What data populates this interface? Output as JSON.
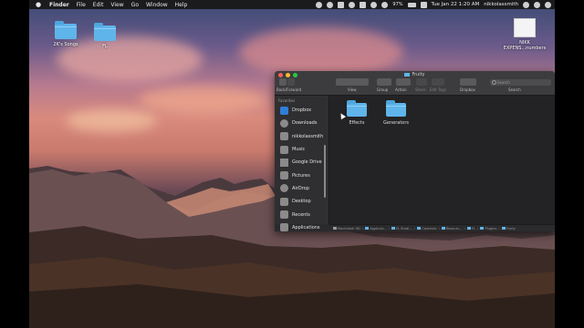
{
  "menubar": {
    "apple": "",
    "items": [
      "Finder",
      "File",
      "Edit",
      "View",
      "Go",
      "Window",
      "Help"
    ],
    "battery": "97%",
    "datetime": "Tue Jan 22  1:20 AM",
    "user": "nikkolassmith"
  },
  "desktop": [
    {
      "label": "2K's Songs"
    },
    {
      "label": "FL"
    },
    {
      "label": "NIKK\nEXPENS...numbers"
    }
  ],
  "finder": {
    "title": "Fruity",
    "toolbar": {
      "nav_label": "Back/Forward",
      "view_label": "View",
      "group_label": "Group",
      "action_label": "Action",
      "share_label": "Share",
      "edit_tags_label": "Edit Tags",
      "dropbox_label": "Dropbox",
      "search_label": "Search",
      "search_placeholder": "Search"
    },
    "sidebar": {
      "heading": "Favorites",
      "items": [
        {
          "label": "Dropbox",
          "icon": "dropbox-icon"
        },
        {
          "label": "Downloads",
          "icon": "downloads-icon"
        },
        {
          "label": "nikkolassmith",
          "icon": "home-icon"
        },
        {
          "label": "Music",
          "icon": "music-icon"
        },
        {
          "label": "Google Drive",
          "icon": "google-drive-icon"
        },
        {
          "label": "Pictures",
          "icon": "pictures-icon"
        },
        {
          "label": "AirDrop",
          "icon": "airdrop-icon"
        },
        {
          "label": "Desktop",
          "icon": "desktop-icon"
        },
        {
          "label": "Recents",
          "icon": "recents-icon"
        },
        {
          "label": "Applications",
          "icon": "applications-icon"
        }
      ]
    },
    "items": [
      {
        "label": "Effects"
      },
      {
        "label": "Generators"
      }
    ],
    "path": [
      "Macintosh HD",
      "Applicat...",
      "FL Studi...",
      "Contents",
      "Resourc...",
      "FL",
      "Plugins",
      "Fruity"
    ]
  },
  "colors": {
    "folder": "#5fb4ea",
    "close": "#fc5f57",
    "minimize": "#fdbb2e",
    "maximize": "#28c840"
  }
}
